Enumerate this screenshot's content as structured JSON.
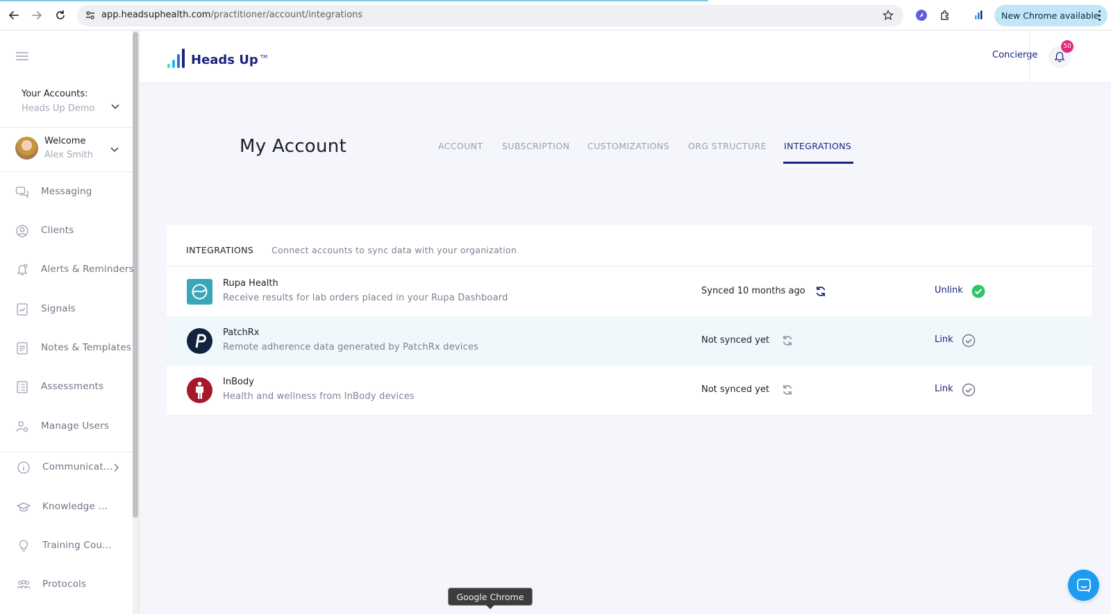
{
  "browser": {
    "url_host": "app.headsuphealth.com",
    "url_path": "/practitioner/account/integrations",
    "new_chrome_label": "New Chrome available",
    "tooltip": "Google Chrome"
  },
  "sidebar": {
    "accounts_label": "Your Accounts:",
    "account_name": "Heads Up Demo",
    "welcome_label": "Welcome",
    "user_name": "Alex Smith",
    "items": [
      {
        "label": "Messaging",
        "icon": "messaging-icon"
      },
      {
        "label": "Clients",
        "icon": "clients-icon"
      },
      {
        "label": "Alerts & Reminders",
        "icon": "alert-icon"
      },
      {
        "label": "Signals",
        "icon": "signals-icon"
      },
      {
        "label": "Notes & Templates",
        "icon": "notes-icon"
      },
      {
        "label": "Assessments",
        "icon": "assessments-icon"
      },
      {
        "label": "Manage Users",
        "icon": "manage-users-icon"
      }
    ],
    "lower_items": [
      {
        "label": "Communicat...",
        "icon": "info-icon"
      },
      {
        "label": "Knowledge ...",
        "icon": "graduation-cap-icon"
      },
      {
        "label": "Training Cou...",
        "icon": "lightbulb-icon"
      },
      {
        "label": "Protocols",
        "icon": "protocols-icon"
      }
    ]
  },
  "header": {
    "logo_text": "Heads Up",
    "logo_tm": "TM",
    "concierge": "Concierge",
    "notification_count": "50"
  },
  "page": {
    "title": "My Account",
    "tabs": [
      "ACCOUNT",
      "SUBSCRIPTION",
      "CUSTOMIZATIONS",
      "ORG STRUCTURE",
      "INTEGRATIONS"
    ],
    "active_tab": "INTEGRATIONS"
  },
  "integrations": {
    "heading": "INTEGRATIONS",
    "subheading": "Connect accounts to sync data with your organization",
    "rows": [
      {
        "name": "Rupa Health",
        "description": "Receive results for lab orders placed in your Rupa Dashboard",
        "status": "Synced 10 months ago",
        "action": "Unlink",
        "linked": true
      },
      {
        "name": "PatchRx",
        "description": "Remote adherence data generated by PatchRx devices",
        "status": "Not synced yet",
        "action": "Link",
        "linked": false
      },
      {
        "name": "InBody",
        "description": "Health and wellness from InBody devices",
        "status": "Not synced yet",
        "action": "Link",
        "linked": false
      }
    ]
  },
  "colors": {
    "brand_navy": "#1a237e",
    "linked_green": "#2ec56b",
    "badge_pink": "#e0297d",
    "chat_blue": "#1d9bf0"
  }
}
